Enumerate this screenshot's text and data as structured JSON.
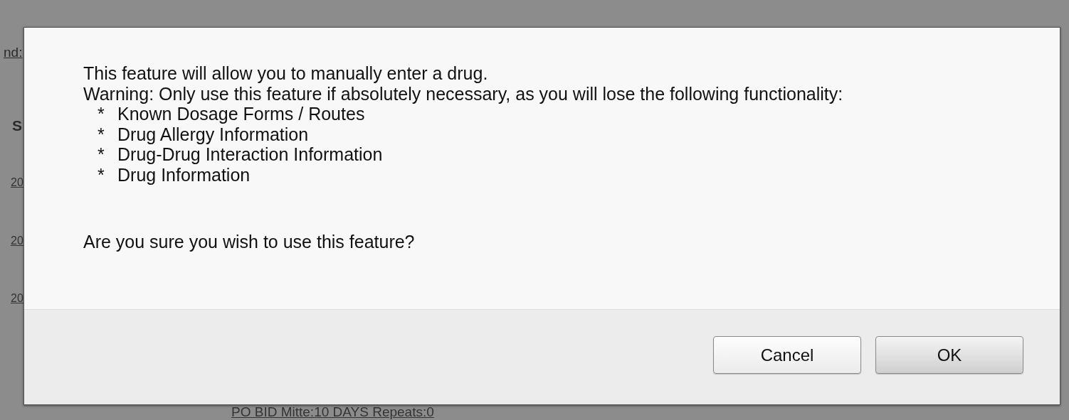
{
  "background": {
    "filter_label": "nd:",
    "column_header": "S",
    "dates": [
      "20",
      "20",
      "20"
    ],
    "medication_tail": "PO BID Mitte:10 DAYS Repeats:0"
  },
  "dialog": {
    "lines": [
      "This feature will allow you to manually enter a drug.",
      "Warning: Only use this feature if absolutely necessary, as you will lose the following functionality:"
    ],
    "bullets": [
      {
        "marker": "*",
        "text": "Known Dosage Forms / Routes"
      },
      {
        "marker": "*",
        "text": "Drug Allergy Information"
      },
      {
        "marker": "*",
        "text": "Drug-Drug Interaction Information"
      },
      {
        "marker": "*",
        "text": "Drug Information"
      }
    ],
    "question": "Are you sure you wish to use this feature?",
    "buttons": [
      {
        "label": "Cancel",
        "default": false
      },
      {
        "label": "OK",
        "default": true
      }
    ]
  }
}
